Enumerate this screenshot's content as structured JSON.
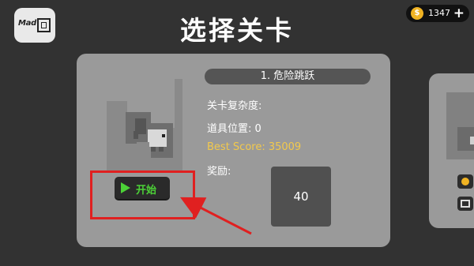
{
  "header": {
    "logo_text": "Mad",
    "title": "选择关卡",
    "coins": "1347",
    "add_coins_symbol": "+"
  },
  "level_card": {
    "level_name": "1. 危险跳跃",
    "complexity_label": "关卡复杂度:",
    "item_position_label": "道具位置: 0",
    "best_score_label": "Best Score: 35009",
    "reward_label": "奖励:",
    "reward_value": "40",
    "start_label": "开始"
  },
  "colors": {
    "background": "#323232",
    "card": "#9a9a9a",
    "accent_green": "#4cd137",
    "best_score_yellow": "#f2c94c",
    "highlight_red": "#e02020",
    "coin_gold": "#f0b323"
  },
  "icons": [
    "coin-icon",
    "plus-icon",
    "play-icon",
    "film-icon"
  ]
}
